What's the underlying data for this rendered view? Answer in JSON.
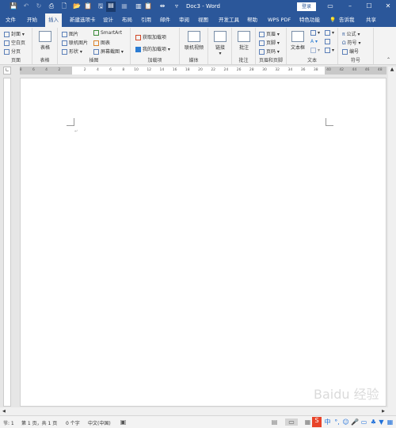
{
  "window": {
    "title": "Doc3 - Word",
    "login": "登录",
    "minimize": "–",
    "maximize": "☐",
    "close": "✕"
  },
  "tabs": [
    "文件",
    "开始",
    "插入",
    "新建选项卡",
    "设计",
    "布局",
    "引用",
    "邮件",
    "审阅",
    "视图",
    "开发工具",
    "帮助",
    "WPS PDF",
    "特色功能"
  ],
  "active_tab": "插入",
  "tell_me": "告诉我",
  "share": "共享",
  "ribbon": {
    "pages": {
      "label": "页面",
      "items": [
        "封面",
        "空白页",
        "分页"
      ]
    },
    "tables": {
      "label": "表格",
      "items": [
        "表格"
      ]
    },
    "illustrations": {
      "label": "插图",
      "items": [
        "图片",
        "联机图片",
        "形状",
        "SmartArt",
        "图表",
        "屏幕截图"
      ]
    },
    "addins": {
      "label": "加载项",
      "items": [
        "获取加载项",
        "我的加载项"
      ]
    },
    "media": {
      "label": "媒体",
      "items": [
        "联机视频"
      ]
    },
    "links": {
      "items": [
        "链接"
      ]
    },
    "comments": {
      "label": "批注",
      "items": [
        "批注"
      ]
    },
    "header_footer": {
      "label": "页眉和页脚",
      "items": [
        "页眉",
        "页脚",
        "页码"
      ]
    },
    "text": {
      "label": "文本",
      "items": [
        "文本框"
      ]
    },
    "symbols": {
      "label": "符号",
      "items": [
        "公式",
        "符号",
        "编号"
      ]
    }
  },
  "ruler": {
    "left": [
      "8",
      "6",
      "4",
      "2"
    ],
    "right": [
      "2",
      "4",
      "6",
      "8",
      "10",
      "12",
      "14",
      "16",
      "18",
      "20",
      "22",
      "24",
      "26",
      "28",
      "30",
      "32",
      "34",
      "36",
      "38"
    ],
    "margin": [
      "40",
      "42",
      "44",
      "46",
      "48"
    ]
  },
  "status": {
    "section": "节: 1",
    "page": "第 1 页，共 1 页",
    "words": "0 个字",
    "language": "中文(中国)"
  },
  "ime": {
    "lang": "中"
  },
  "watermark": "Baidu 经验",
  "colors": {
    "accent": "#2b579a",
    "background": "#e6e6e6"
  }
}
